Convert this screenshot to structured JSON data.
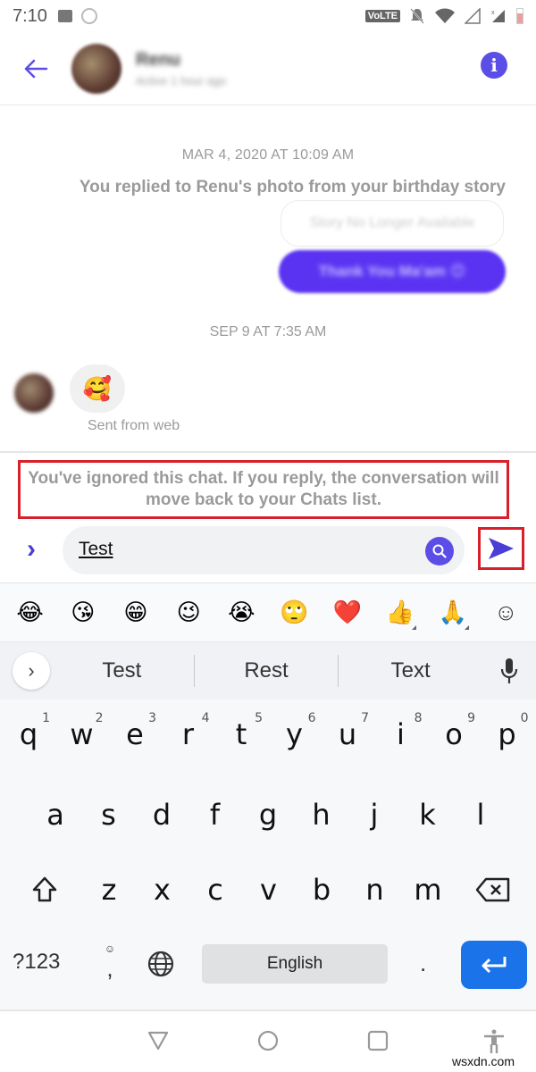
{
  "status_bar": {
    "time": "7:10",
    "left_icons": [
      "gallery-icon",
      "messenger-icon"
    ],
    "volte_label": "VoLTE",
    "right_icons": [
      "volte-icon",
      "bell-off-icon",
      "wifi-icon",
      "signal-icon",
      "signal-roaming-icon",
      "battery-icon"
    ]
  },
  "header": {
    "contact_name": "Renu",
    "contact_status": "Active 1 hour ago",
    "back_icon": "arrow-left-icon",
    "info_icon": "info-icon",
    "info_glyph": "i"
  },
  "chat": {
    "timestamp_1": "MAR 4, 2020 AT 10:09 AM",
    "story_reply_note": "You replied to Renu's photo from your birthday story",
    "story_placeholder": "Story No Longer Available",
    "sent_message": "Thank You Ma'am 😊",
    "timestamp_2": "SEP 9 AT 7:35 AM",
    "received_emoji": "🥰",
    "received_footer": "Sent from web"
  },
  "notice": {
    "ignored_text": "You've ignored this chat. If you reply, the conversation will move back to your Chats list."
  },
  "composer": {
    "expand_glyph": "›",
    "input_value": "Test",
    "search_icon": "search-icon",
    "send_icon": "send-icon"
  },
  "keyboard": {
    "emoji_suggestions": [
      "😂",
      "😘",
      "😁",
      "😉",
      "😭",
      "🙄",
      "❤️",
      "👍",
      "🙏"
    ],
    "emoji_key_glyph": "☺",
    "suggestions": [
      "Test",
      "Rest",
      "Text"
    ],
    "suggestion_expand_glyph": "›",
    "row1": [
      {
        "key": "q",
        "hint": "1"
      },
      {
        "key": "w",
        "hint": "2"
      },
      {
        "key": "e",
        "hint": "3"
      },
      {
        "key": "r",
        "hint": "4"
      },
      {
        "key": "t",
        "hint": "5"
      },
      {
        "key": "y",
        "hint": "6"
      },
      {
        "key": "u",
        "hint": "7"
      },
      {
        "key": "i",
        "hint": "8"
      },
      {
        "key": "o",
        "hint": "9"
      },
      {
        "key": "p",
        "hint": "0"
      }
    ],
    "row2": [
      "a",
      "s",
      "d",
      "f",
      "g",
      "h",
      "j",
      "k",
      "l"
    ],
    "row3": [
      "z",
      "x",
      "c",
      "v",
      "b",
      "n",
      "m"
    ],
    "symbols_label": "?123",
    "comma_label": ",",
    "comma_hint": "☺",
    "space_label": "English",
    "period_label": ".",
    "enter_icon": "enter-icon"
  },
  "navbar": {
    "buttons": [
      "back-nav-icon",
      "home-nav-icon",
      "recents-nav-icon",
      "accessibility-icon"
    ]
  },
  "watermark": "wsxdn.com",
  "colors": {
    "accent": "#5b4ee6",
    "sent_bubble": "#5a33f2",
    "highlight_border": "#d8202a",
    "enter_key": "#1a73e8"
  }
}
